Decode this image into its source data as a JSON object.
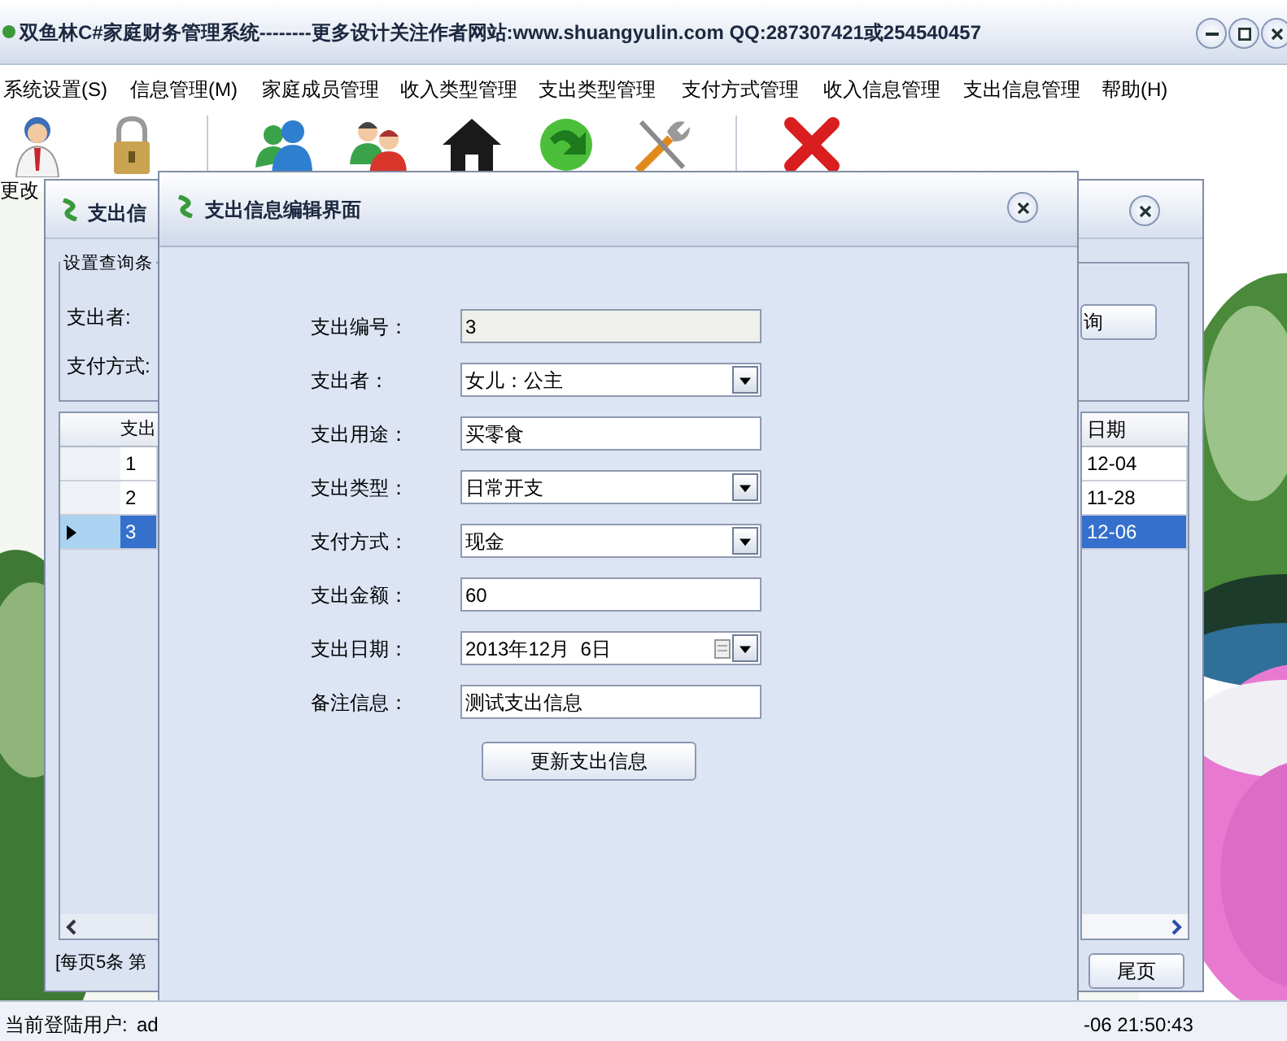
{
  "window": {
    "title": "双鱼林C#家庭财务管理系统--------更多设计关注作者网站:www.shuangyulin.com  QQ:287307421或254540457"
  },
  "menu": [
    "系统设置(S)",
    "信息管理(M)",
    "家庭成员管理",
    "收入类型管理",
    "支出类型管理",
    "支付方式管理",
    "收入信息管理",
    "支出信息管理",
    "帮助(H)"
  ],
  "toolbar_caption": "更改",
  "query_window": {
    "title": "支出信",
    "group_title": "设置查询条",
    "labels": [
      "支出者:",
      "支付方式:"
    ],
    "query_button": "询",
    "grid": {
      "columns": [
        "支出",
        "日期"
      ],
      "rows": [
        {
          "id": "1",
          "date": "12-04",
          "selected": false
        },
        {
          "id": "2",
          "date": "11-28",
          "selected": false
        },
        {
          "id": "3",
          "date": "12-06",
          "selected": true
        }
      ]
    },
    "pager_text": "[每页5条 第",
    "last_button": "尾页"
  },
  "dialog": {
    "title": "支出信息编辑界面",
    "fields": [
      {
        "label": "支出编号：",
        "value": "3",
        "kind": "readonly"
      },
      {
        "label": "支出者：",
        "value": "女儿：公主",
        "kind": "combo"
      },
      {
        "label": "支出用途：",
        "value": "买零食",
        "kind": "text"
      },
      {
        "label": "支出类型：",
        "value": "日常开支",
        "kind": "combo"
      },
      {
        "label": "支付方式：",
        "value": "现金",
        "kind": "combo"
      },
      {
        "label": "支出金额：",
        "value": "60",
        "kind": "text"
      },
      {
        "label": "支出日期：",
        "value": "2013年12月  6日",
        "kind": "date"
      },
      {
        "label": "备注信息：",
        "value": "测试支出信息",
        "kind": "text"
      }
    ],
    "submit": "更新支出信息"
  },
  "status_bar": {
    "user_label": "当前登陆用户:",
    "user": "ad",
    "time": "-06 21:50:43"
  }
}
